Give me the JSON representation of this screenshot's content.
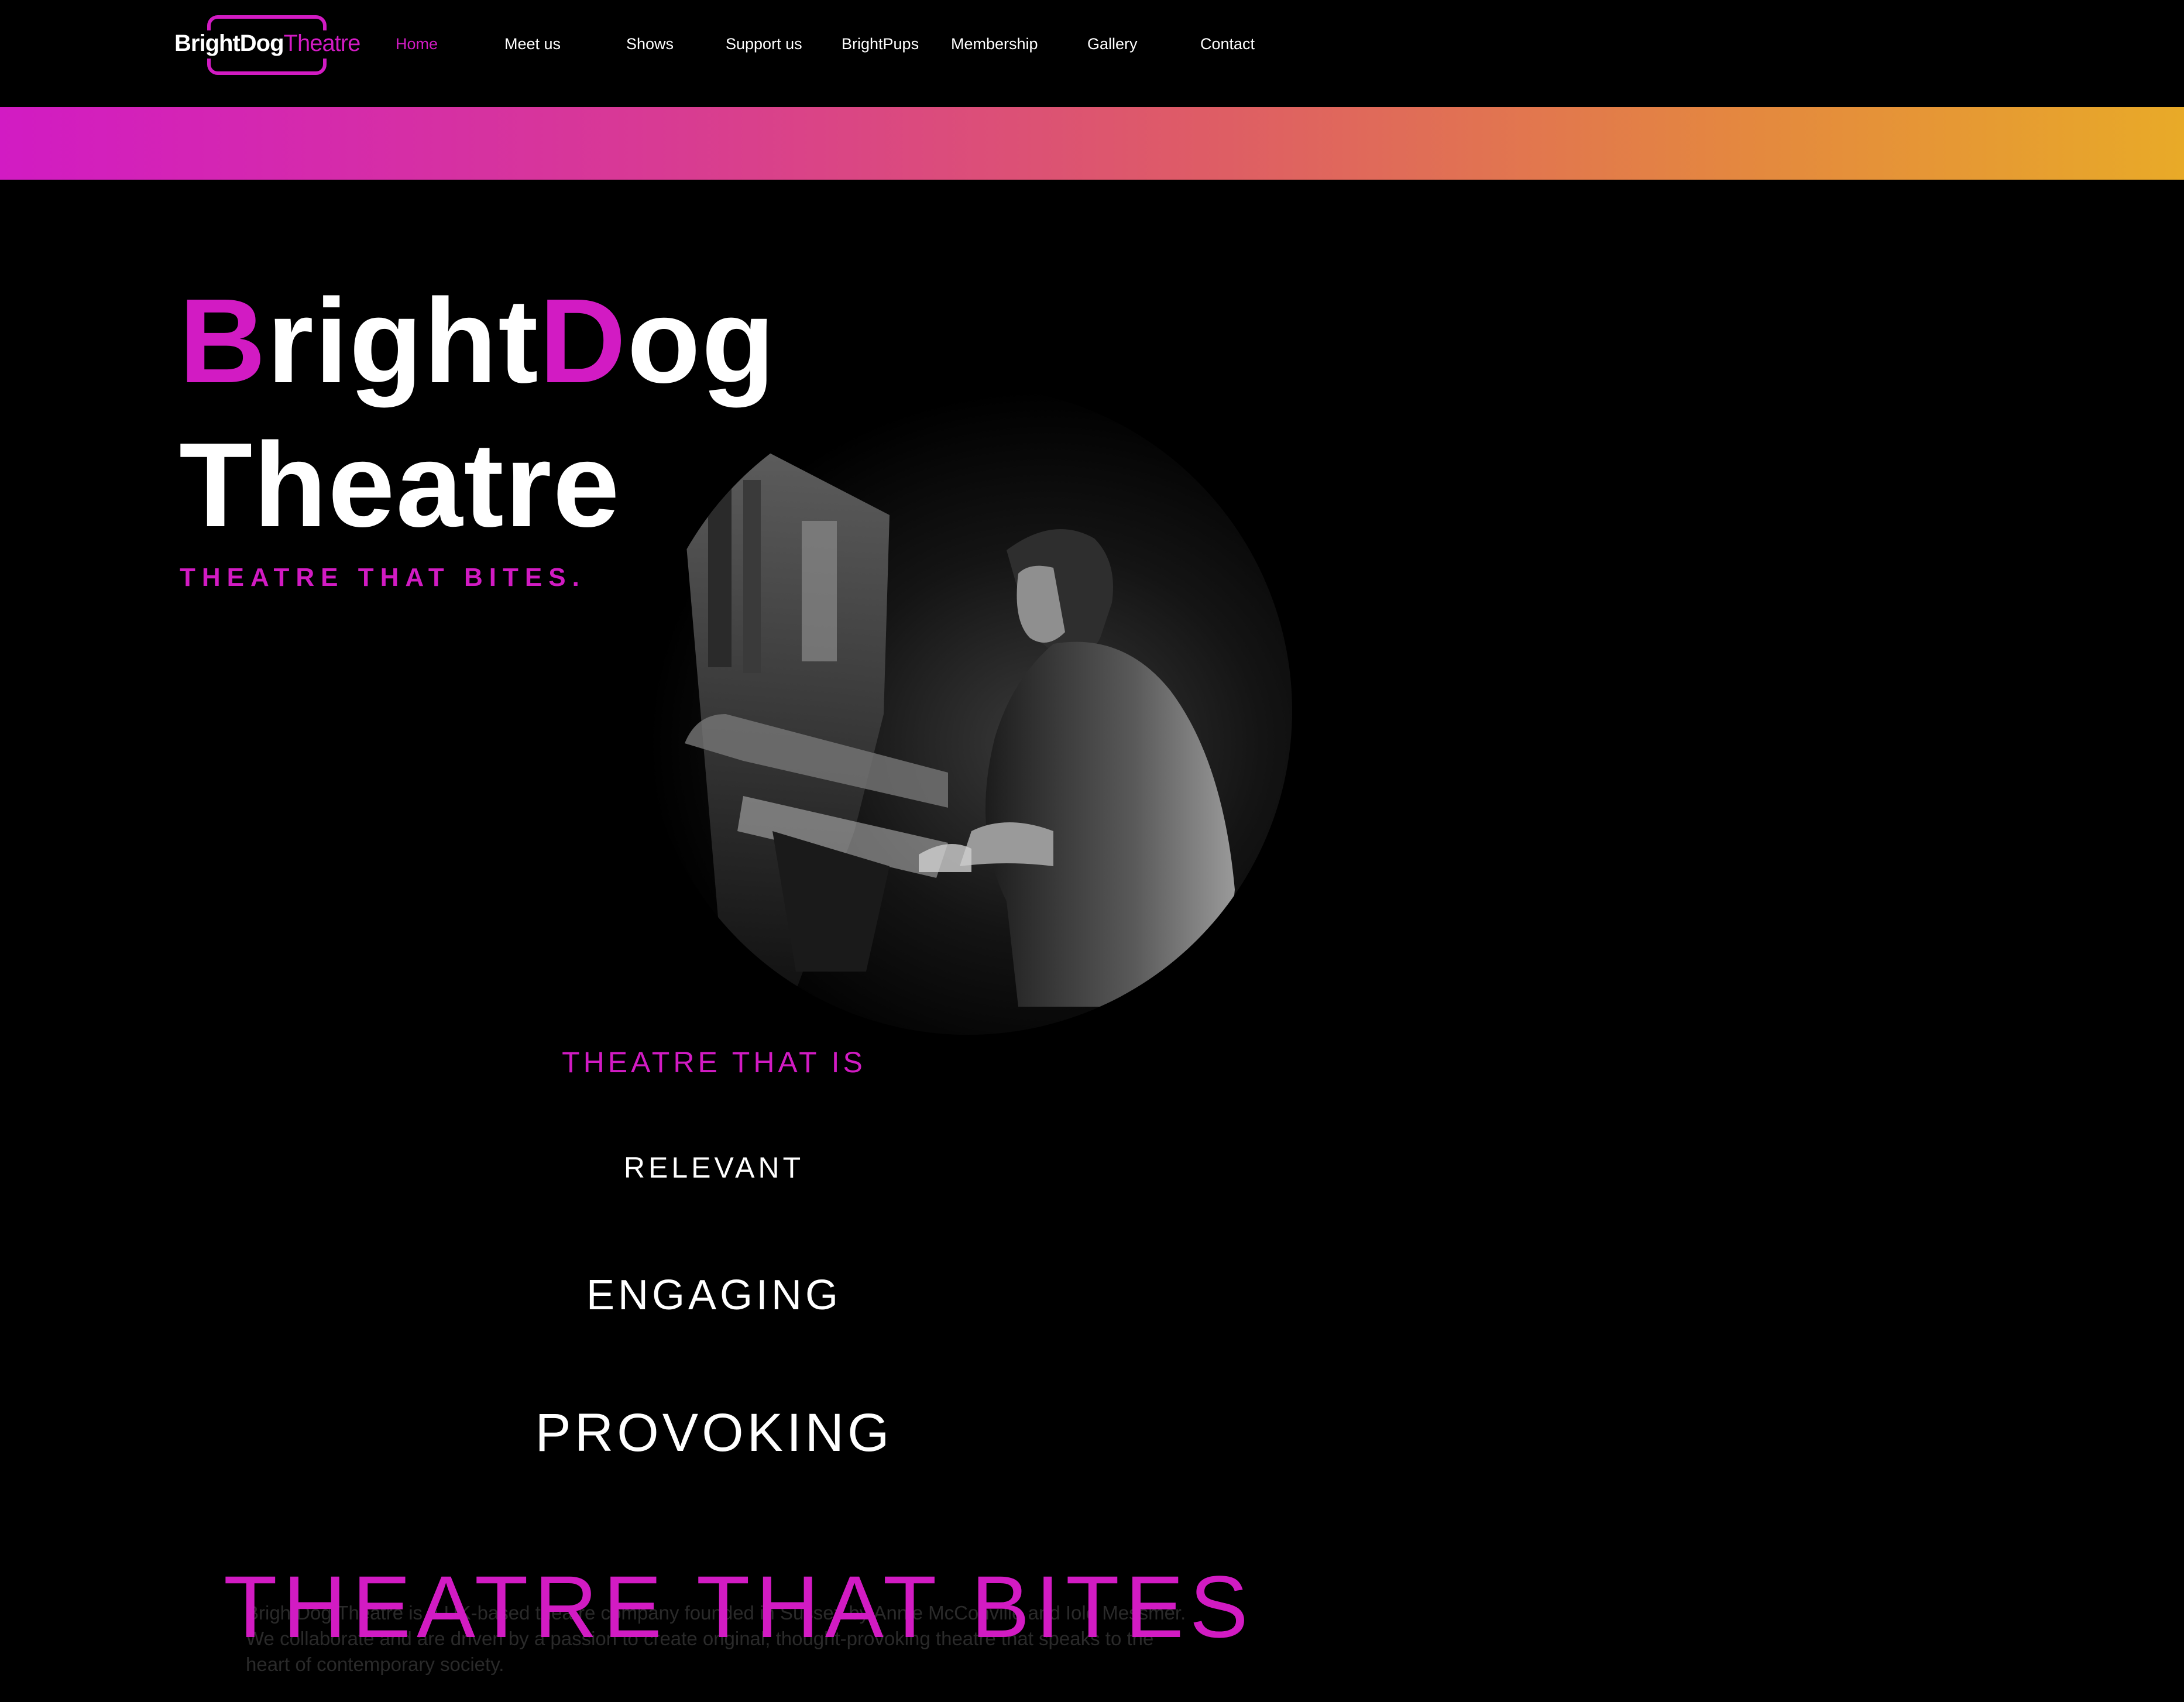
{
  "nav": {
    "logo": {
      "brand": "BrightDog",
      "suffix": "Theatre"
    },
    "items": [
      {
        "label": "Home",
        "active": true
      },
      {
        "label": "Meet us",
        "active": false
      },
      {
        "label": "Shows",
        "active": false
      },
      {
        "label": "Support us",
        "active": false
      },
      {
        "label": "BrightPups",
        "active": false
      },
      {
        "label": "Membership",
        "active": false
      },
      {
        "label": "Gallery",
        "active": false
      },
      {
        "label": "Contact",
        "active": false
      }
    ]
  },
  "hero": {
    "title_b": "B",
    "title_right": "right",
    "title_d": "D",
    "title_og": "og",
    "title_line2": "Theatre",
    "tagline": "THEATRE THAT BITES."
  },
  "photo": {
    "alt_icon": "pianist-photo"
  },
  "word_list": {
    "intro": "THEATRE THAT IS",
    "words": [
      "RELEVANT",
      "ENGAGING",
      "PROVOKING"
    ]
  },
  "bottom": {
    "heading": "THEATRE THAT BITES",
    "body": "BrightDog Theatre is a UK-based theatre company founded in Sussex by Annie McConville and Iolo Messmer. We collaborate and are driven by a passion to create original, thought-provoking theatre that speaks to the heart of contemporary society."
  },
  "colors": {
    "accent": "#d21bc3",
    "gradient_start": "#d21bc3",
    "gradient_end": "#e8aa28",
    "background": "#000000",
    "text": "#ffffff"
  }
}
